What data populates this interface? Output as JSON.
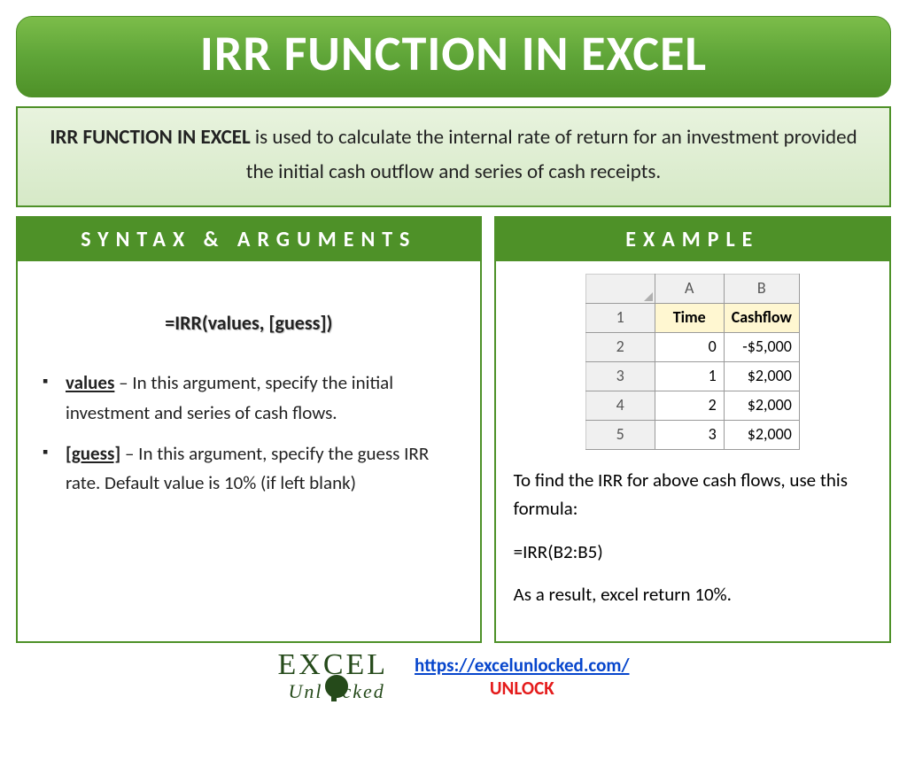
{
  "title": "IRR FUNCTION IN EXCEL",
  "description": {
    "bold": "IRR FUNCTION IN EXCEL",
    "rest": " is used to calculate the internal rate of return for an investment provided the initial cash outflow and series of cash receipts."
  },
  "syntax": {
    "header": "SYNTAX & ARGUMENTS",
    "formula": "=IRR(values, [guess])",
    "args": [
      {
        "name": "values",
        "desc": " – In this argument, specify the initial investment and series of cash flows."
      },
      {
        "name": "[guess]",
        "desc": " – In this argument, specify the guess IRR rate. Default value is 10% (if left blank)"
      }
    ]
  },
  "example": {
    "header": "EXAMPLE",
    "cols": [
      "A",
      "B"
    ],
    "headers": [
      "Time",
      "Cashflow"
    ],
    "rows": [
      {
        "n": "1"
      },
      {
        "n": "2",
        "a": "0",
        "b": "-$5,000"
      },
      {
        "n": "3",
        "a": "1",
        "b": "$2,000"
      },
      {
        "n": "4",
        "a": "2",
        "b": "$2,000"
      },
      {
        "n": "5",
        "a": "3",
        "b": "$2,000"
      }
    ],
    "intro": "To find the IRR for above cash flows, use this formula:",
    "formula": "=IRR(B2:B5)",
    "result": "As a result, excel return 10%."
  },
  "footer": {
    "logo_main": "E   CEL",
    "logo_sub": "Unl   cked",
    "url": "https://excelunlocked.com/",
    "unlock": "UNLOCK"
  }
}
